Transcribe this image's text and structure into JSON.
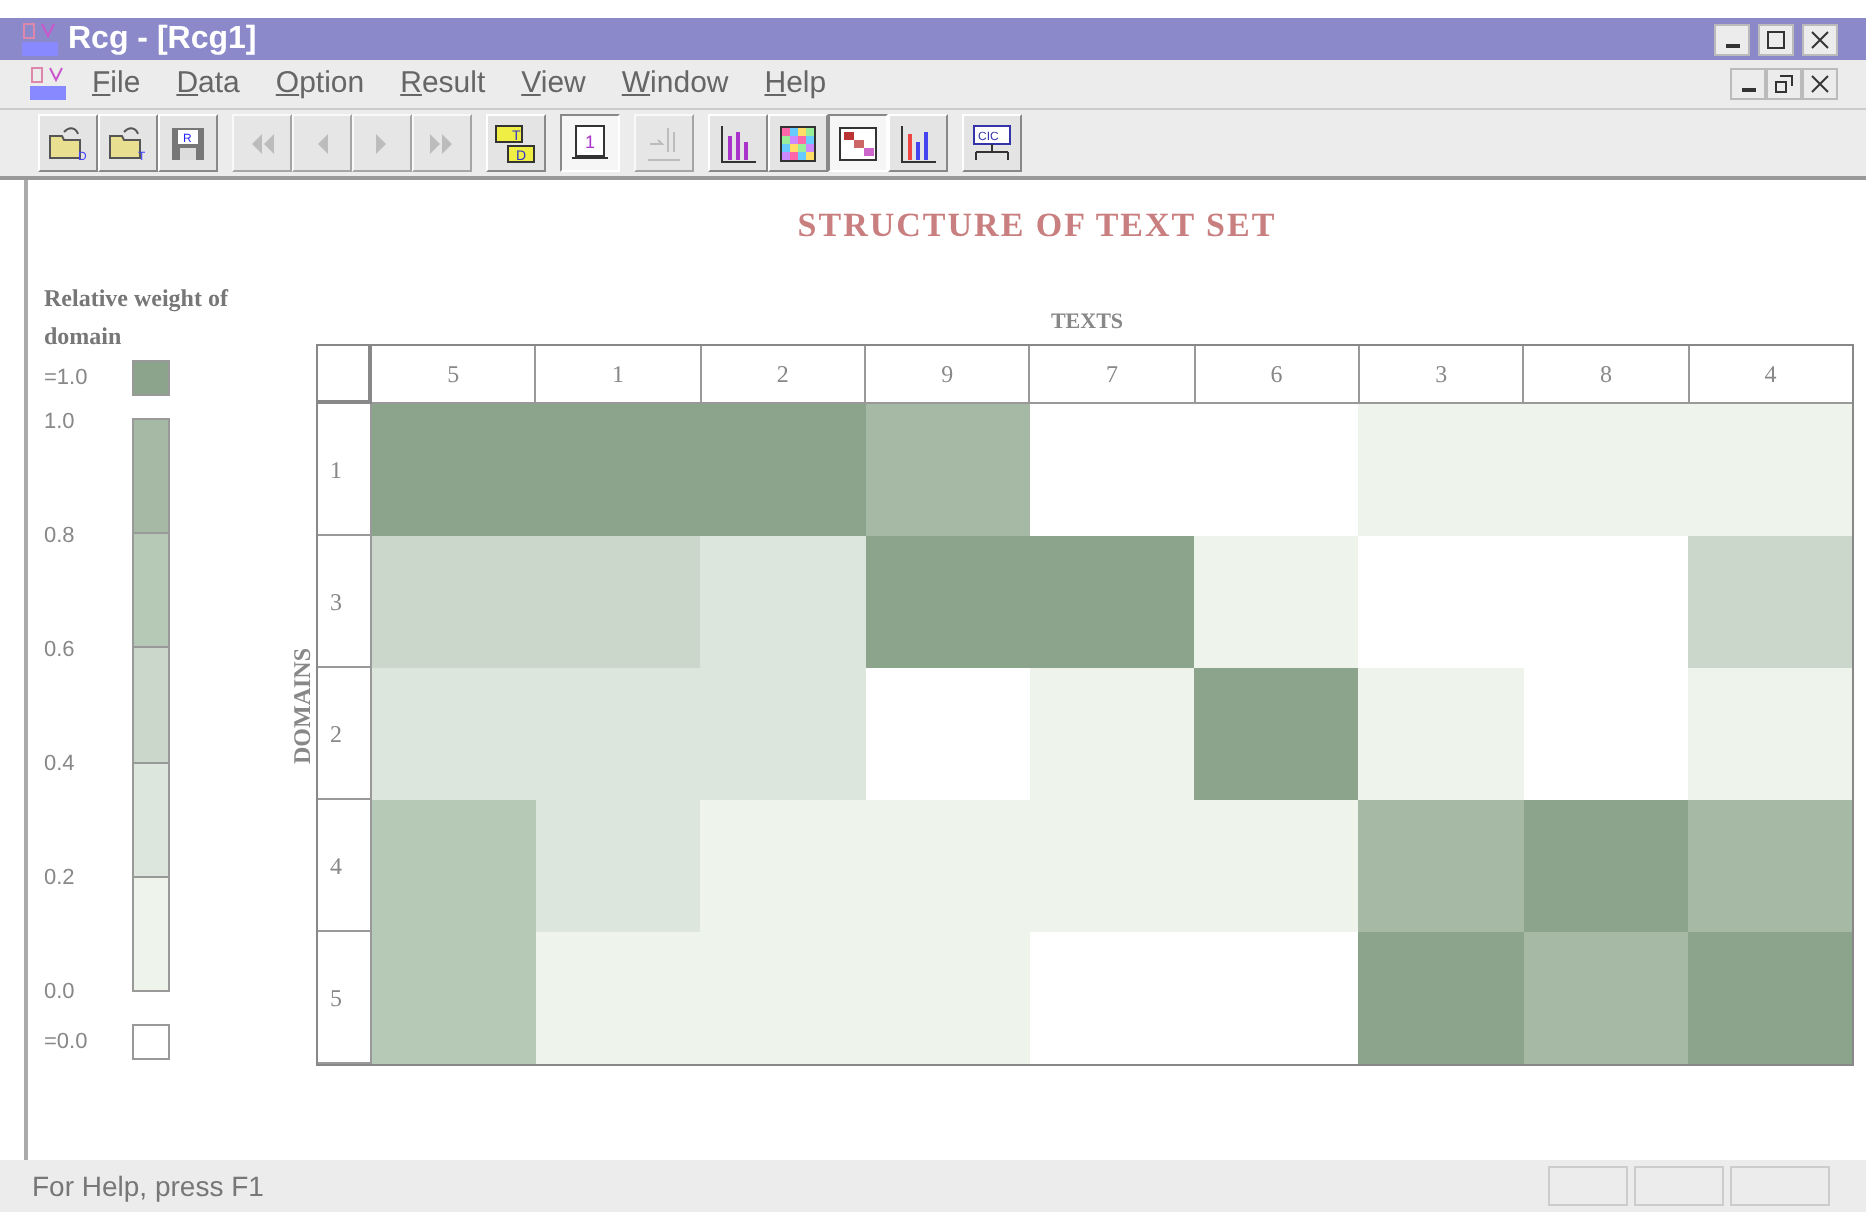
{
  "window": {
    "title": "Rcg - [Rcg1]"
  },
  "menu": [
    "File",
    "Data",
    "Option",
    "Result",
    "View",
    "Window",
    "Help"
  ],
  "toolbar": [
    {
      "kind": "open",
      "label": "D",
      "disabled": false,
      "selected": false
    },
    {
      "kind": "open",
      "label": "T",
      "disabled": false,
      "selected": false
    },
    {
      "kind": "save",
      "label": "R",
      "disabled": false,
      "selected": false
    },
    {
      "kind": "first",
      "disabled": true,
      "selected": false
    },
    {
      "kind": "prev",
      "disabled": true,
      "selected": false
    },
    {
      "kind": "next",
      "disabled": true,
      "selected": false
    },
    {
      "kind": "last",
      "disabled": true,
      "selected": false
    },
    {
      "kind": "textdomain",
      "label": "T",
      "label2": "D",
      "disabled": false,
      "selected": false
    },
    {
      "kind": "page",
      "label": "1",
      "disabled": false,
      "selected": true
    },
    {
      "kind": "export",
      "disabled": true,
      "selected": false
    },
    {
      "kind": "bars",
      "disabled": false,
      "selected": false
    },
    {
      "kind": "grid",
      "disabled": false,
      "selected": false
    },
    {
      "kind": "diagonal",
      "disabled": false,
      "selected": true
    },
    {
      "kind": "bars2",
      "disabled": false,
      "selected": false
    },
    {
      "kind": "network",
      "label": "CIC",
      "disabled": false,
      "selected": false
    }
  ],
  "chart": {
    "title": "STRUCTURE OF TEXT SET",
    "x_title": "TEXTS",
    "y_title": "DOMAINS",
    "columns": [
      "5",
      "1",
      "2",
      "9",
      "7",
      "6",
      "3",
      "8",
      "4"
    ],
    "rows": [
      {
        "label": "1",
        "cells": [
          {
            "color": "#8ba48b"
          },
          {
            "color": "#8ba48b"
          },
          {
            "color": "#8ba48b"
          },
          {
            "color": "#a5b9a5"
          },
          {
            "color": "#ffffff"
          },
          {
            "color": "#ffffff"
          },
          {
            "color": "#eef3ec"
          },
          {
            "color": "#eef3ec"
          },
          {
            "color": "#eef3ec"
          }
        ]
      },
      {
        "label": "3",
        "cells": [
          {
            "color": "#cbd7cb"
          },
          {
            "color": "#cbd7cb"
          },
          {
            "color": "#dde6dd"
          },
          {
            "color": "#8ba48b"
          },
          {
            "color": "#8ba48b"
          },
          {
            "color": "#eef3ec"
          },
          {
            "color": "#ffffff"
          },
          {
            "color": "#ffffff"
          },
          {
            "color": "#cbd7cb"
          }
        ]
      },
      {
        "label": "2",
        "cells": [
          {
            "color": "#dde6dd"
          },
          {
            "color": "#dde6dd"
          },
          {
            "color": "#dde6dd"
          },
          {
            "color": "#ffffff"
          },
          {
            "color": "#eef3ec"
          },
          {
            "color": "#8ba48b"
          },
          {
            "color": "#eef3ec"
          },
          {
            "color": "#ffffff"
          },
          {
            "color": "#eef3ec"
          }
        ]
      },
      {
        "label": "4",
        "cells": [
          {
            "color": "#b6c8b6"
          },
          {
            "color": "#dde6dd"
          },
          {
            "color": "#eef3ec"
          },
          {
            "color": "#eef3ec"
          },
          {
            "color": "#eef3ec"
          },
          {
            "color": "#eef3ec"
          },
          {
            "color": "#a5b9a5"
          },
          {
            "color": "#8ba48b"
          },
          {
            "color": "#a5b9a5"
          }
        ]
      },
      {
        "label": "5",
        "cells": [
          {
            "color": "#b6c8b6"
          },
          {
            "color": "#eef3ec"
          },
          {
            "color": "#eef3ec"
          },
          {
            "color": "#eef3ec"
          },
          {
            "color": "#ffffff"
          },
          {
            "color": "#ffffff"
          },
          {
            "color": "#8ba48b"
          },
          {
            "color": "#a5b9a5"
          },
          {
            "color": "#8ba48b"
          }
        ]
      }
    ]
  },
  "legend": {
    "title": "Relative weight of domain",
    "top_label": "=1.0",
    "bottom_label": "=0.0",
    "scale": [
      {
        "label": "1.0",
        "color": "#a5b9a5"
      },
      {
        "label": "0.8",
        "color": "#b6c8b6"
      },
      {
        "label": "0.6",
        "color": "#cbd7cb"
      },
      {
        "label": "0.4",
        "color": "#dde6dd"
      },
      {
        "label": "0.2",
        "color": "#eef3ec"
      }
    ],
    "end_label": "0.0"
  },
  "status_bar": {
    "text": "For Help, press F1"
  }
}
